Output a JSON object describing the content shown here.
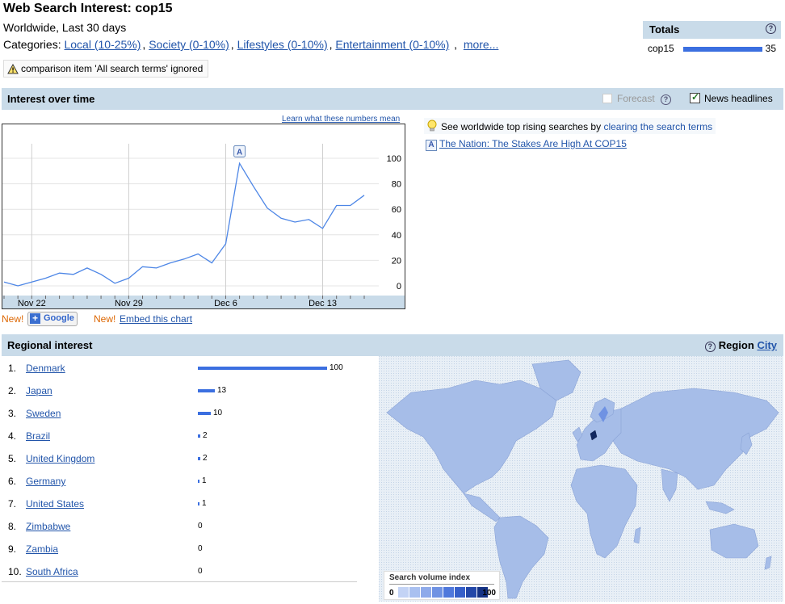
{
  "header": {
    "title": "Web Search Interest: cop15",
    "subtitle": "Worldwide, Last 30 days",
    "categories_label": "Categories:",
    "categories": [
      "Local (10-25%)",
      "Society (0-10%)",
      "Lifestyles (0-10%)",
      "Entertainment (0-10%)"
    ],
    "more_label": "more...",
    "warning": "comparison item 'All search terms' ignored"
  },
  "totals": {
    "title": "Totals",
    "term": "cop15",
    "value": "35",
    "bar_fraction": 0.35
  },
  "interest": {
    "title": "Interest over time",
    "forecast_label": "Forecast",
    "news_label": "News headlines",
    "learn_link": "Learn what these numbers mean",
    "new_label": "New!",
    "add_google_label": "Google",
    "embed_label": "Embed this chart",
    "rising_text": "See worldwide top rising searches by",
    "rising_link": "clearing the search terms",
    "news_item_letter": "A",
    "news_item": "The Nation: The Stakes Are High At COP15"
  },
  "chart_data": {
    "type": "line",
    "x_tick_labels": [
      "Nov 22",
      "Nov 29",
      "Dec 6",
      "Dec 13"
    ],
    "y_tick_labels": [
      "0",
      "20",
      "40",
      "60",
      "80",
      "100"
    ],
    "ylim": [
      0,
      100
    ],
    "series": [
      {
        "values": [
          3,
          0,
          3,
          6,
          10,
          9,
          14,
          9,
          2,
          6,
          15,
          14,
          18,
          21,
          25,
          18,
          33,
          96,
          78,
          61,
          53,
          50,
          52,
          45,
          63,
          63,
          71
        ]
      }
    ],
    "annotation": {
      "label": "A",
      "index": 17
    },
    "grid": true
  },
  "regional": {
    "title": "Regional interest",
    "region_label": "Region",
    "city_label": "City",
    "rows": [
      {
        "rank": "1.",
        "name": "Denmark",
        "value": 100
      },
      {
        "rank": "2.",
        "name": "Japan",
        "value": 13
      },
      {
        "rank": "3.",
        "name": "Sweden",
        "value": 10
      },
      {
        "rank": "4.",
        "name": "Brazil",
        "value": 2
      },
      {
        "rank": "5.",
        "name": "United Kingdom",
        "value": 2
      },
      {
        "rank": "6.",
        "name": "Germany",
        "value": 1
      },
      {
        "rank": "7.",
        "name": "United States",
        "value": 1
      },
      {
        "rank": "8.",
        "name": "Zimbabwe",
        "value": 0
      },
      {
        "rank": "9.",
        "name": "Zambia",
        "value": 0
      },
      {
        "rank": "10.",
        "name": "South Africa",
        "value": 0
      }
    ],
    "legend_title": "Search volume index",
    "legend_min": "0",
    "legend_max": "100",
    "legend_colors": [
      "#c3d3f5",
      "#a9c0f0",
      "#8eaaea",
      "#6f92e3",
      "#4f78dc",
      "#365fc9",
      "#2347a8",
      "#153285"
    ]
  }
}
